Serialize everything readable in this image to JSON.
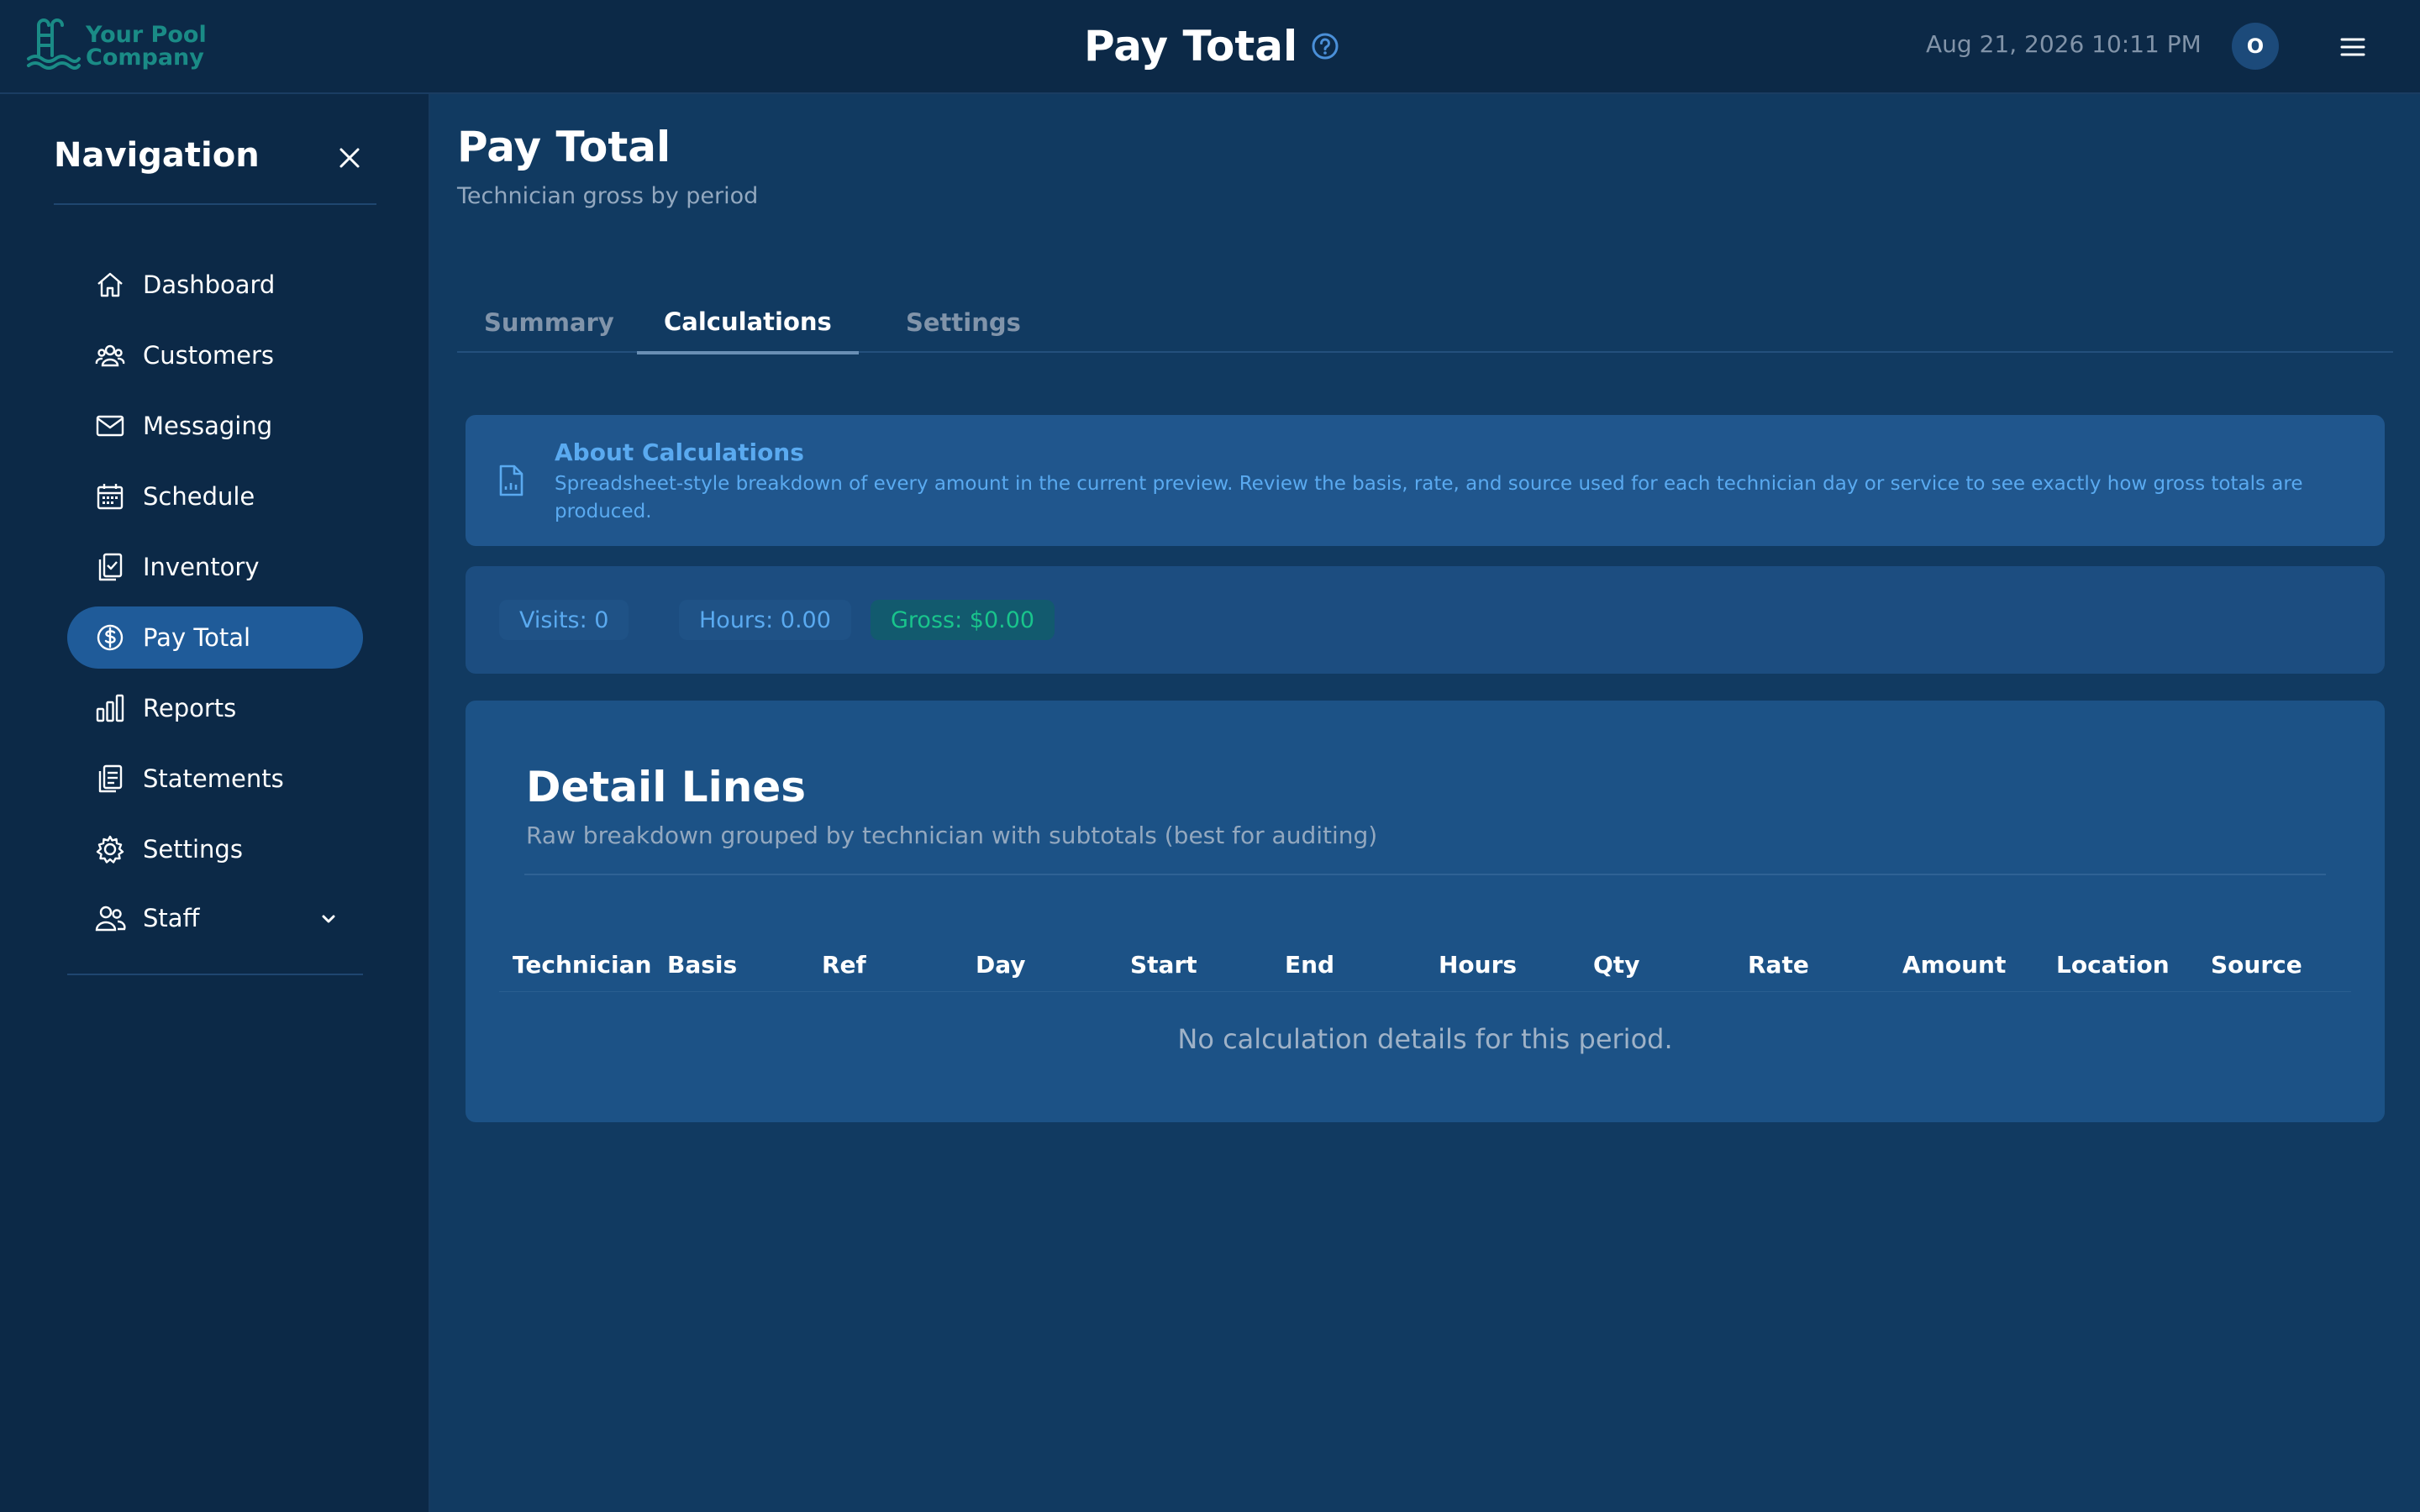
{
  "header": {
    "logo_line1": "Your Pool",
    "logo_line2": "Company",
    "title": "Pay Total",
    "datetime": "Aug 21, 2026 10:11 PM",
    "avatar_initial": "O"
  },
  "sidebar": {
    "title": "Navigation",
    "items": [
      {
        "label": "Dashboard",
        "icon": "home-icon"
      },
      {
        "label": "Customers",
        "icon": "users-icon"
      },
      {
        "label": "Messaging",
        "icon": "mail-icon"
      },
      {
        "label": "Schedule",
        "icon": "calendar-icon"
      },
      {
        "label": "Inventory",
        "icon": "clipboard-check-icon"
      },
      {
        "label": "Pay Total",
        "icon": "dollar-circle-icon",
        "active": true
      },
      {
        "label": "Reports",
        "icon": "bar-chart-icon"
      },
      {
        "label": "Statements",
        "icon": "statements-icon"
      },
      {
        "label": "Settings",
        "icon": "gear-icon"
      },
      {
        "label": "Staff",
        "icon": "staff-icon",
        "expandable": true
      }
    ]
  },
  "main": {
    "title": "Pay Total",
    "subtitle": "Technician gross by period",
    "tabs": [
      {
        "label": "Summary"
      },
      {
        "label": "Calculations",
        "active": true
      },
      {
        "label": "Settings"
      }
    ],
    "about": {
      "title": "About Calculations",
      "text": "Spreadsheet-style breakdown of every amount in the current preview. Review the basis, rate, and source used for each technician day or service to see exactly how gross totals are produced."
    },
    "stats": {
      "visits": "Visits: 0",
      "hours": "Hours: 0.00",
      "gross": "Gross: $0.00"
    },
    "detail": {
      "title": "Detail Lines",
      "subtitle": "Raw breakdown grouped by technician with subtotals (best for auditing)",
      "columns": [
        "Technician",
        "Basis",
        "Ref",
        "Day",
        "Start",
        "End",
        "Hours",
        "Qty",
        "Rate",
        "Amount",
        "Location",
        "Source"
      ],
      "empty_message": "No calculation details for this period."
    }
  },
  "colors": {
    "background": "#113a61",
    "header_bg": "#0c2947",
    "active_nav": "#1f5b99",
    "info_accent": "#5aaaf0",
    "gross_accent": "#19c48c"
  }
}
